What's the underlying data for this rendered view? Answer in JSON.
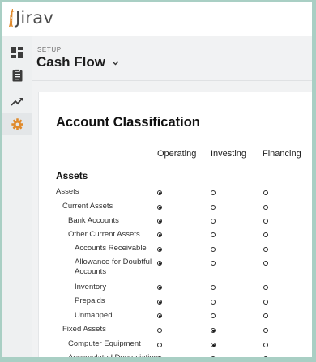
{
  "app": {
    "logo_text": "Jirav"
  },
  "sidebar": {
    "items": [
      {
        "name": "dashboard",
        "icon": "dashboard-grid-icon"
      },
      {
        "name": "reports",
        "icon": "clipboard-icon"
      },
      {
        "name": "forecast",
        "icon": "trend-icon"
      },
      {
        "name": "settings",
        "icon": "gear-icon",
        "active": true
      }
    ]
  },
  "header": {
    "breadcrumb": "SETUP",
    "title": "Cash Flow"
  },
  "card": {
    "title": "Account Classification",
    "columns": [
      "Operating",
      "Investing",
      "Financing"
    ],
    "section": "Assets",
    "rows": [
      {
        "label": "Assets",
        "selected": "Operating"
      },
      {
        "label": "Current Assets",
        "selected": "Operating"
      },
      {
        "label": "Bank Accounts",
        "selected": "Operating"
      },
      {
        "label": "Other Current Assets",
        "selected": "Operating"
      },
      {
        "label": "Accounts Receivable",
        "selected": "Operating"
      },
      {
        "label": "Allowance for Doubtful Accounts",
        "selected": "Operating"
      },
      {
        "label": "Inventory",
        "selected": "Operating"
      },
      {
        "label": "Prepaids",
        "selected": "Operating"
      },
      {
        "label": "Unmapped",
        "selected": "Operating"
      },
      {
        "label": "Fixed Assets",
        "selected": "Investing"
      },
      {
        "label": "Computer Equipment",
        "selected": "Investing"
      },
      {
        "label": "Accumulated Depreciation",
        "selected": "Investing"
      }
    ]
  },
  "colors": {
    "frame": "#a9cfc4",
    "accent_orange": "#e08a2c",
    "sidebar_bg": "#eef0f1",
    "content_bg": "#f1f2f3"
  }
}
